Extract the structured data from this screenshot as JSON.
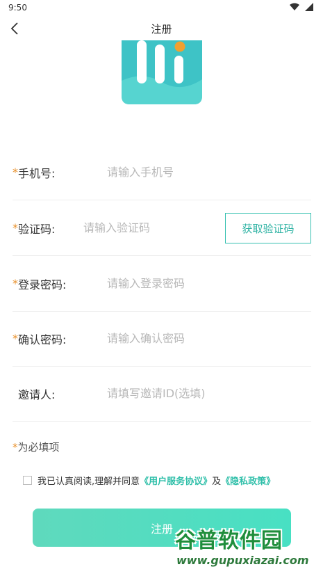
{
  "status_bar": {
    "time": "9:50"
  },
  "nav": {
    "title": "注册"
  },
  "form": {
    "required_mark": "*",
    "phone": {
      "label": "手机号:",
      "placeholder": "请输入手机号"
    },
    "code": {
      "label": "验证码:",
      "placeholder": "请输入验证码",
      "button": "获取验证码"
    },
    "password": {
      "label": "登录密码:",
      "placeholder": "请输入登录密码"
    },
    "confirm": {
      "label": "确认密码:",
      "placeholder": "请输入确认密码"
    },
    "inviter": {
      "label": "邀请人:",
      "placeholder": "请填写邀请ID(选填)"
    }
  },
  "required_note": {
    "mark": "*",
    "text": "为必填项"
  },
  "agreement": {
    "prefix": "我已认真阅读,理解并同意",
    "user_agreement": "《用户服务协议》",
    "conjunction": "及",
    "privacy_policy": "《隐私政策》",
    "checked": false
  },
  "submit": {
    "label": "注册"
  },
  "watermark": {
    "title": "谷普软件园",
    "url": "www.gupuxiazai.com"
  },
  "colors": {
    "accent": "#35c0b0",
    "required": "#e8902a",
    "button_start": "#5fd9bd",
    "button_end": "#48e0c3",
    "logo": "#3ec3c6",
    "logo_dot": "#f0a030"
  },
  "icons": {
    "back": "chevron-left-icon",
    "wifi": "wifi-icon",
    "signal": "signal-icon"
  }
}
